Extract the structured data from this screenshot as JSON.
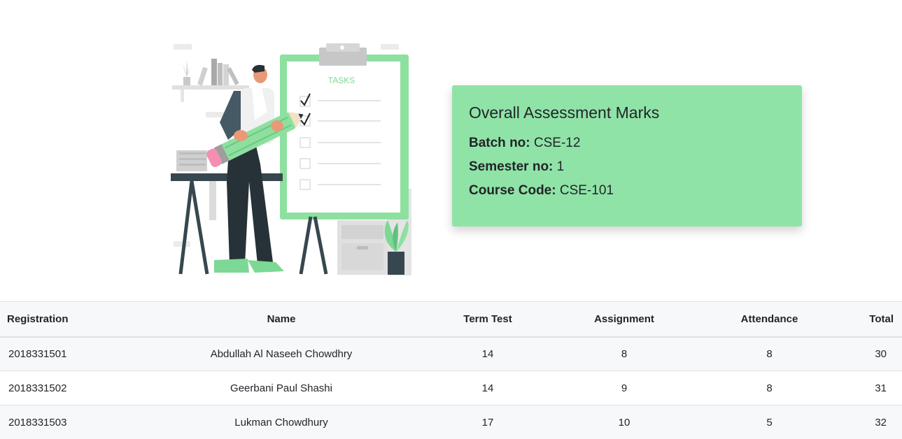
{
  "illustration": {
    "clipboard_label": "TASKS"
  },
  "card": {
    "title": "Overall Assessment Marks",
    "batch_label": "Batch no:",
    "batch_value": "CSE-12",
    "semester_label": "Semester no:",
    "semester_value": "1",
    "course_label": "Course Code:",
    "course_value": "CSE-101",
    "background_color": "#90e3a7"
  },
  "table": {
    "headers": {
      "registration": "Registration",
      "name": "Name",
      "term_test": "Term Test",
      "assignment": "Assignment",
      "attendance": "Attendance",
      "total": "Total"
    },
    "rows": [
      {
        "registration": "2018331501",
        "name": "Abdullah Al Naseeh Chowdhry",
        "term_test": "14",
        "assignment": "8",
        "attendance": "8",
        "total": "30"
      },
      {
        "registration": "2018331502",
        "name": "Geerbani Paul Shashi",
        "term_test": "14",
        "assignment": "9",
        "attendance": "8",
        "total": "31"
      },
      {
        "registration": "2018331503",
        "name": "Lukman Chowdhury",
        "term_test": "17",
        "assignment": "10",
        "attendance": "5",
        "total": "32"
      }
    ]
  }
}
